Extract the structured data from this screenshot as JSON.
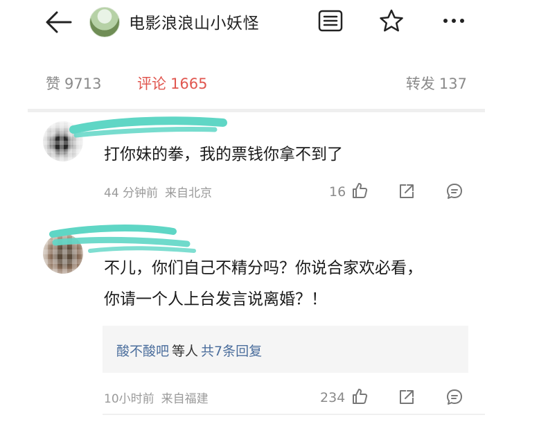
{
  "header": {
    "title": "电影浪浪山小妖怪",
    "back_icon": "arrow-left-icon",
    "list_icon": "list-icon",
    "star_icon": "star-icon",
    "more_icon": "more-icon"
  },
  "stats": {
    "likes_label": "赞",
    "likes_count": "9713",
    "comments_label": "评论",
    "comments_count": "1665",
    "reposts_label": "转发",
    "reposts_count": "137",
    "active_color": "#e0564f"
  },
  "comments": [
    {
      "text": "打你妹的拳，我的票钱你拿不到了",
      "time": "44 分钟前",
      "source": "来自北京",
      "likes": "16"
    },
    {
      "text_line1": "不儿，你们自己不精分吗？你说合家欢必看，",
      "text_line2": "你请一个人上台发言说离婚？！",
      "reply_user": "酸不酸吧",
      "reply_mid": "等人",
      "reply_count": "共7条回复",
      "time": "10小时前",
      "source": "来自福建",
      "likes": "234"
    }
  ]
}
